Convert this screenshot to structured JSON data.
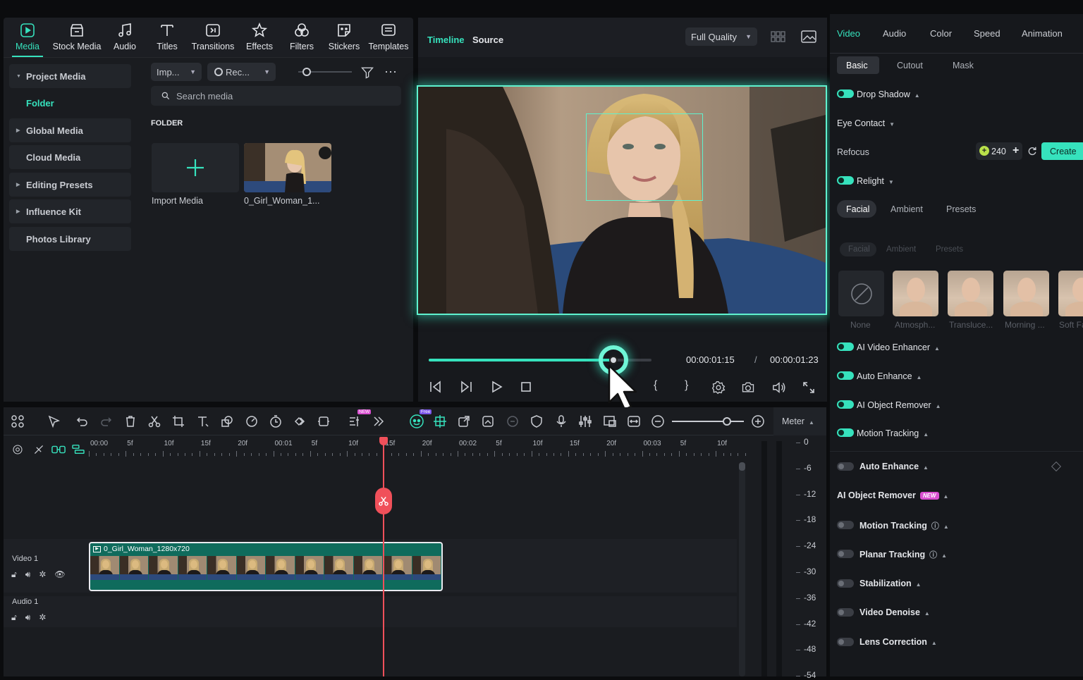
{
  "toolbar": {
    "items": [
      {
        "label": "Media",
        "icon": "media-icon",
        "active": true
      },
      {
        "label": "Stock Media",
        "icon": "stock-media-icon"
      },
      {
        "label": "Audio",
        "icon": "audio-note-icon"
      },
      {
        "label": "Titles",
        "icon": "titles-t-icon"
      },
      {
        "label": "Transitions",
        "icon": "transitions-icon"
      },
      {
        "label": "Effects",
        "icon": "effects-star-icon"
      },
      {
        "label": "Filters",
        "icon": "filters-icon"
      },
      {
        "label": "Stickers",
        "icon": "stickers-icon"
      },
      {
        "label": "Templates",
        "icon": "templates-icon"
      }
    ]
  },
  "library": {
    "sidebar": {
      "project_media": "Project Media",
      "folder": "Folder",
      "global_media": "Global Media",
      "cloud_media": "Cloud Media",
      "editing_presets": "Editing Presets",
      "influence_kit": "Influence Kit",
      "photos_library": "Photos Library"
    },
    "import_dropdown": "Imp...",
    "record_dropdown": "Rec...",
    "search_placeholder": "Search media",
    "folder_heading": "FOLDER",
    "import_media_label": "Import Media",
    "clip_label": "0_Girl_Woman_1..."
  },
  "preview": {
    "tab_timeline": "Timeline",
    "tab_source": "Source",
    "quality": "Full Quality",
    "current_time": "00:00:01:15",
    "separator": "/",
    "total_time": "00:00:01:23",
    "progress": 0.83,
    "in_mark": "{",
    "out_mark": "}"
  },
  "right_panel": {
    "tabs": [
      "Video",
      "Audio",
      "Color",
      "Speed",
      "Animation"
    ],
    "subtabs": [
      "Basic",
      "Cutout",
      "Mask"
    ],
    "drop_shadow": "Drop Shadow",
    "eye_contact": "Eye Contact",
    "refocus": "Refocus",
    "credits": "240",
    "create": "Create",
    "relight": "Relight",
    "relight_tabs": [
      "Facial",
      "Ambient",
      "Presets"
    ],
    "relight_tabs_faded": [
      "Facial",
      "Ambient",
      "Presets"
    ],
    "presets": [
      "None",
      "Atmosph...",
      "Transluce...",
      "Morning ...",
      "Soft Fa"
    ],
    "ai_video_enhancer": "AI Video Enhancer",
    "auto_enhance_on": "Auto Enhance",
    "ai_object_remover_on": "AI Object Remover",
    "motion_tracking_on": "Motion Tracking",
    "auto_enhance": "Auto Enhance",
    "ai_object_remover": "AI Object Remover",
    "new_badge": "NEW",
    "motion_tracking": "Motion Tracking",
    "planar_tracking": "Planar Tracking",
    "stabilization": "Stabilization",
    "video_denoise": "Video Denoise",
    "lens_correction": "Lens Correction"
  },
  "timeline": {
    "meter": "Meter",
    "new_badge": "NEW",
    "free_badge": "Free",
    "ruler": [
      "00:00",
      "5f",
      "10f",
      "15f",
      "20f",
      "00:01",
      "5f",
      "10f",
      "15f",
      "20f",
      "00:02",
      "5f",
      "10f",
      "15f",
      "20f",
      "00:03",
      "5f",
      "10f"
    ],
    "meter_scale": [
      "0",
      "-6",
      "-12",
      "-18",
      "-24",
      "-30",
      "-36",
      "-42",
      "-48",
      "-54"
    ],
    "video_track": "Video 1",
    "audio_track": "Audio 1",
    "clip_name": "0_Girl_Woman_1280x720"
  },
  "colors": {
    "accent": "#36e2bd",
    "playhead": "#f0505a",
    "clip": "#0f6b5c"
  }
}
